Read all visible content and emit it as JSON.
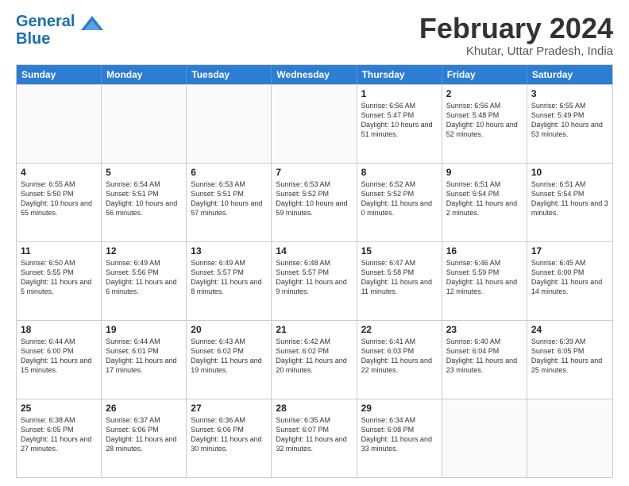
{
  "header": {
    "logo_line1": "General",
    "logo_line2": "Blue",
    "month_title": "February 2024",
    "location": "Khutar, Uttar Pradesh, India"
  },
  "days_of_week": [
    "Sunday",
    "Monday",
    "Tuesday",
    "Wednesday",
    "Thursday",
    "Friday",
    "Saturday"
  ],
  "weeks": [
    [
      {
        "day": "",
        "empty": true
      },
      {
        "day": "",
        "empty": true
      },
      {
        "day": "",
        "empty": true
      },
      {
        "day": "",
        "empty": true
      },
      {
        "day": "1",
        "rise": "6:56 AM",
        "set": "5:47 PM",
        "daylight": "10 hours and 51 minutes."
      },
      {
        "day": "2",
        "rise": "6:56 AM",
        "set": "5:48 PM",
        "daylight": "10 hours and 52 minutes."
      },
      {
        "day": "3",
        "rise": "6:55 AM",
        "set": "5:49 PM",
        "daylight": "10 hours and 53 minutes."
      }
    ],
    [
      {
        "day": "4",
        "rise": "6:55 AM",
        "set": "5:50 PM",
        "daylight": "10 hours and 55 minutes."
      },
      {
        "day": "5",
        "rise": "6:54 AM",
        "set": "5:51 PM",
        "daylight": "10 hours and 56 minutes."
      },
      {
        "day": "6",
        "rise": "6:53 AM",
        "set": "5:51 PM",
        "daylight": "10 hours and 57 minutes."
      },
      {
        "day": "7",
        "rise": "6:53 AM",
        "set": "5:52 PM",
        "daylight": "10 hours and 59 minutes."
      },
      {
        "day": "8",
        "rise": "6:52 AM",
        "set": "5:52 PM",
        "daylight": "11 hours and 0 minutes."
      },
      {
        "day": "9",
        "rise": "6:51 AM",
        "set": "5:54 PM",
        "daylight": "11 hours and 2 minutes."
      },
      {
        "day": "10",
        "rise": "6:51 AM",
        "set": "5:54 PM",
        "daylight": "11 hours and 3 minutes."
      }
    ],
    [
      {
        "day": "11",
        "rise": "6:50 AM",
        "set": "5:55 PM",
        "daylight": "11 hours and 5 minutes."
      },
      {
        "day": "12",
        "rise": "6:49 AM",
        "set": "5:56 PM",
        "daylight": "11 hours and 6 minutes."
      },
      {
        "day": "13",
        "rise": "6:49 AM",
        "set": "5:57 PM",
        "daylight": "11 hours and 8 minutes."
      },
      {
        "day": "14",
        "rise": "6:48 AM",
        "set": "5:57 PM",
        "daylight": "11 hours and 9 minutes."
      },
      {
        "day": "15",
        "rise": "6:47 AM",
        "set": "5:58 PM",
        "daylight": "11 hours and 11 minutes."
      },
      {
        "day": "16",
        "rise": "6:46 AM",
        "set": "5:59 PM",
        "daylight": "11 hours and 12 minutes."
      },
      {
        "day": "17",
        "rise": "6:45 AM",
        "set": "6:00 PM",
        "daylight": "11 hours and 14 minutes."
      }
    ],
    [
      {
        "day": "18",
        "rise": "6:44 AM",
        "set": "6:00 PM",
        "daylight": "11 hours and 15 minutes."
      },
      {
        "day": "19",
        "rise": "6:44 AM",
        "set": "6:01 PM",
        "daylight": "11 hours and 17 minutes."
      },
      {
        "day": "20",
        "rise": "6:43 AM",
        "set": "6:02 PM",
        "daylight": "11 hours and 19 minutes."
      },
      {
        "day": "21",
        "rise": "6:42 AM",
        "set": "6:02 PM",
        "daylight": "11 hours and 20 minutes."
      },
      {
        "day": "22",
        "rise": "6:41 AM",
        "set": "6:03 PM",
        "daylight": "11 hours and 22 minutes."
      },
      {
        "day": "23",
        "rise": "6:40 AM",
        "set": "6:04 PM",
        "daylight": "11 hours and 23 minutes."
      },
      {
        "day": "24",
        "rise": "6:39 AM",
        "set": "6:05 PM",
        "daylight": "11 hours and 25 minutes."
      }
    ],
    [
      {
        "day": "25",
        "rise": "6:38 AM",
        "set": "6:05 PM",
        "daylight": "11 hours and 27 minutes."
      },
      {
        "day": "26",
        "rise": "6:37 AM",
        "set": "6:06 PM",
        "daylight": "11 hours and 28 minutes."
      },
      {
        "day": "27",
        "rise": "6:36 AM",
        "set": "6:06 PM",
        "daylight": "11 hours and 30 minutes."
      },
      {
        "day": "28",
        "rise": "6:35 AM",
        "set": "6:07 PM",
        "daylight": "11 hours and 32 minutes."
      },
      {
        "day": "29",
        "rise": "6:34 AM",
        "set": "6:08 PM",
        "daylight": "11 hours and 33 minutes."
      },
      {
        "day": "",
        "empty": true
      },
      {
        "day": "",
        "empty": true
      }
    ]
  ],
  "labels": {
    "sunrise": "Sunrise:",
    "sunset": "Sunset:",
    "daylight": "Daylight:"
  }
}
